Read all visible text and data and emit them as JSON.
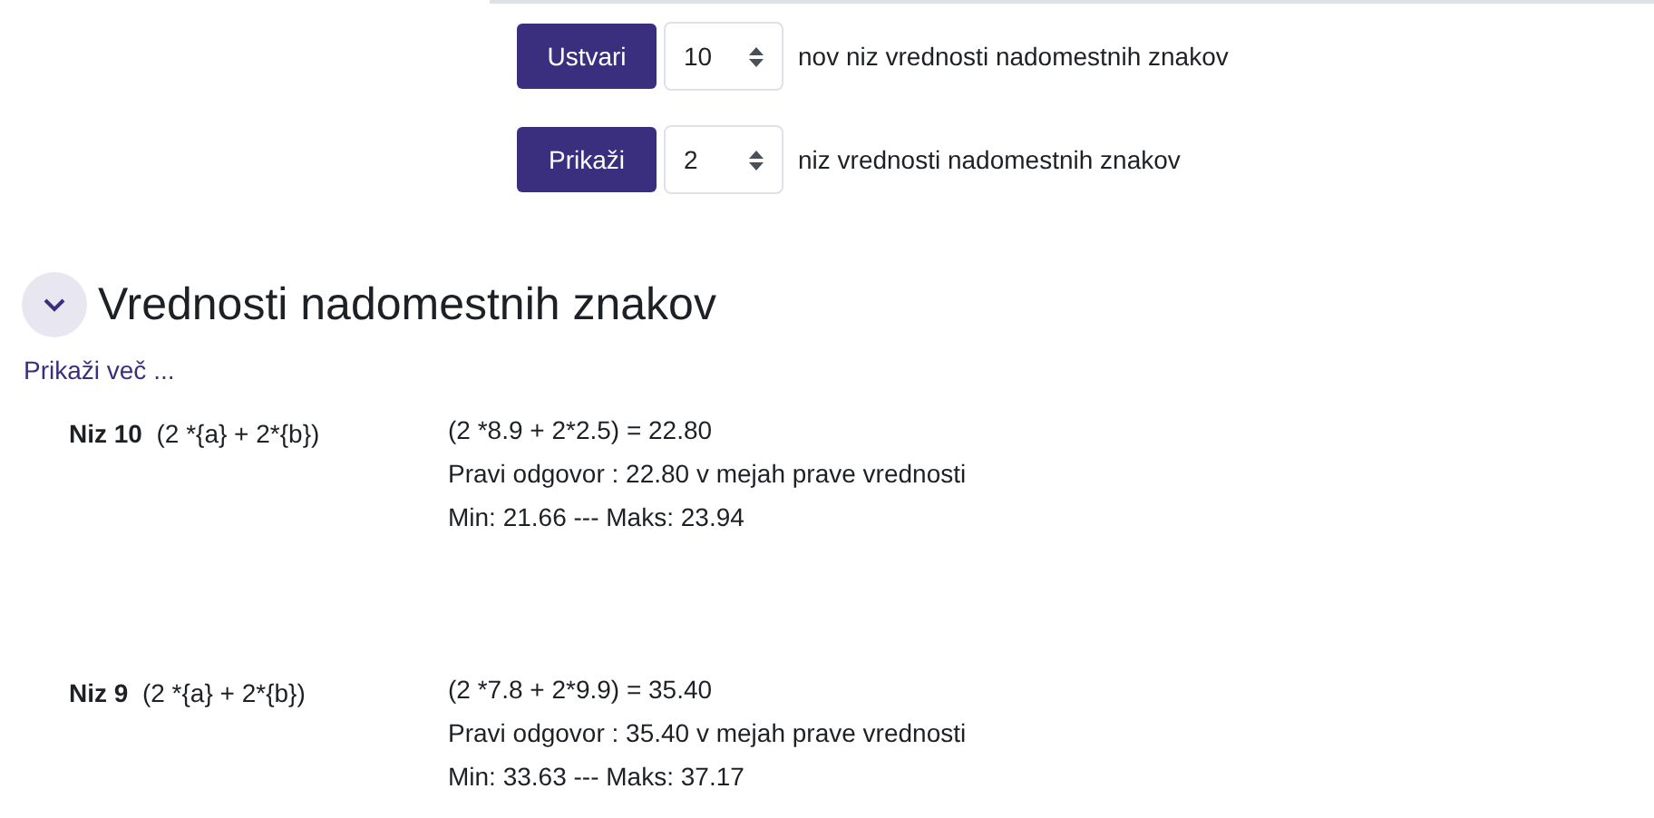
{
  "controls": [
    {
      "button": "Ustvari",
      "value": "10",
      "label": "nov niz vrednosti nadomestnih znakov"
    },
    {
      "button": "Prikaži",
      "value": "2",
      "label": "niz vrednosti nadomestnih znakov"
    }
  ],
  "section": {
    "title": "Vrednosti nadomestnih znakov",
    "expanded": true,
    "more_link": "Prikaži več ...",
    "rows": [
      {
        "name": "Niz 10",
        "formula": "(2 *{a} + 2*{b})",
        "lines": [
          "(2 *8.9 + 2*2.5) = 22.80",
          "Pravi odgovor : 22.80 v mejah prave vrednosti",
          "Min: 21.66 --- Maks: 23.94"
        ]
      },
      {
        "name": "Niz 9",
        "formula": "(2 *{a} + 2*{b})",
        "lines": [
          "(2 *7.8 + 2*9.9) = 35.40",
          "Pravi odgovor : 35.40 v mejah prave vrednosti",
          "Min: 33.63 --- Maks: 37.17"
        ]
      }
    ]
  }
}
